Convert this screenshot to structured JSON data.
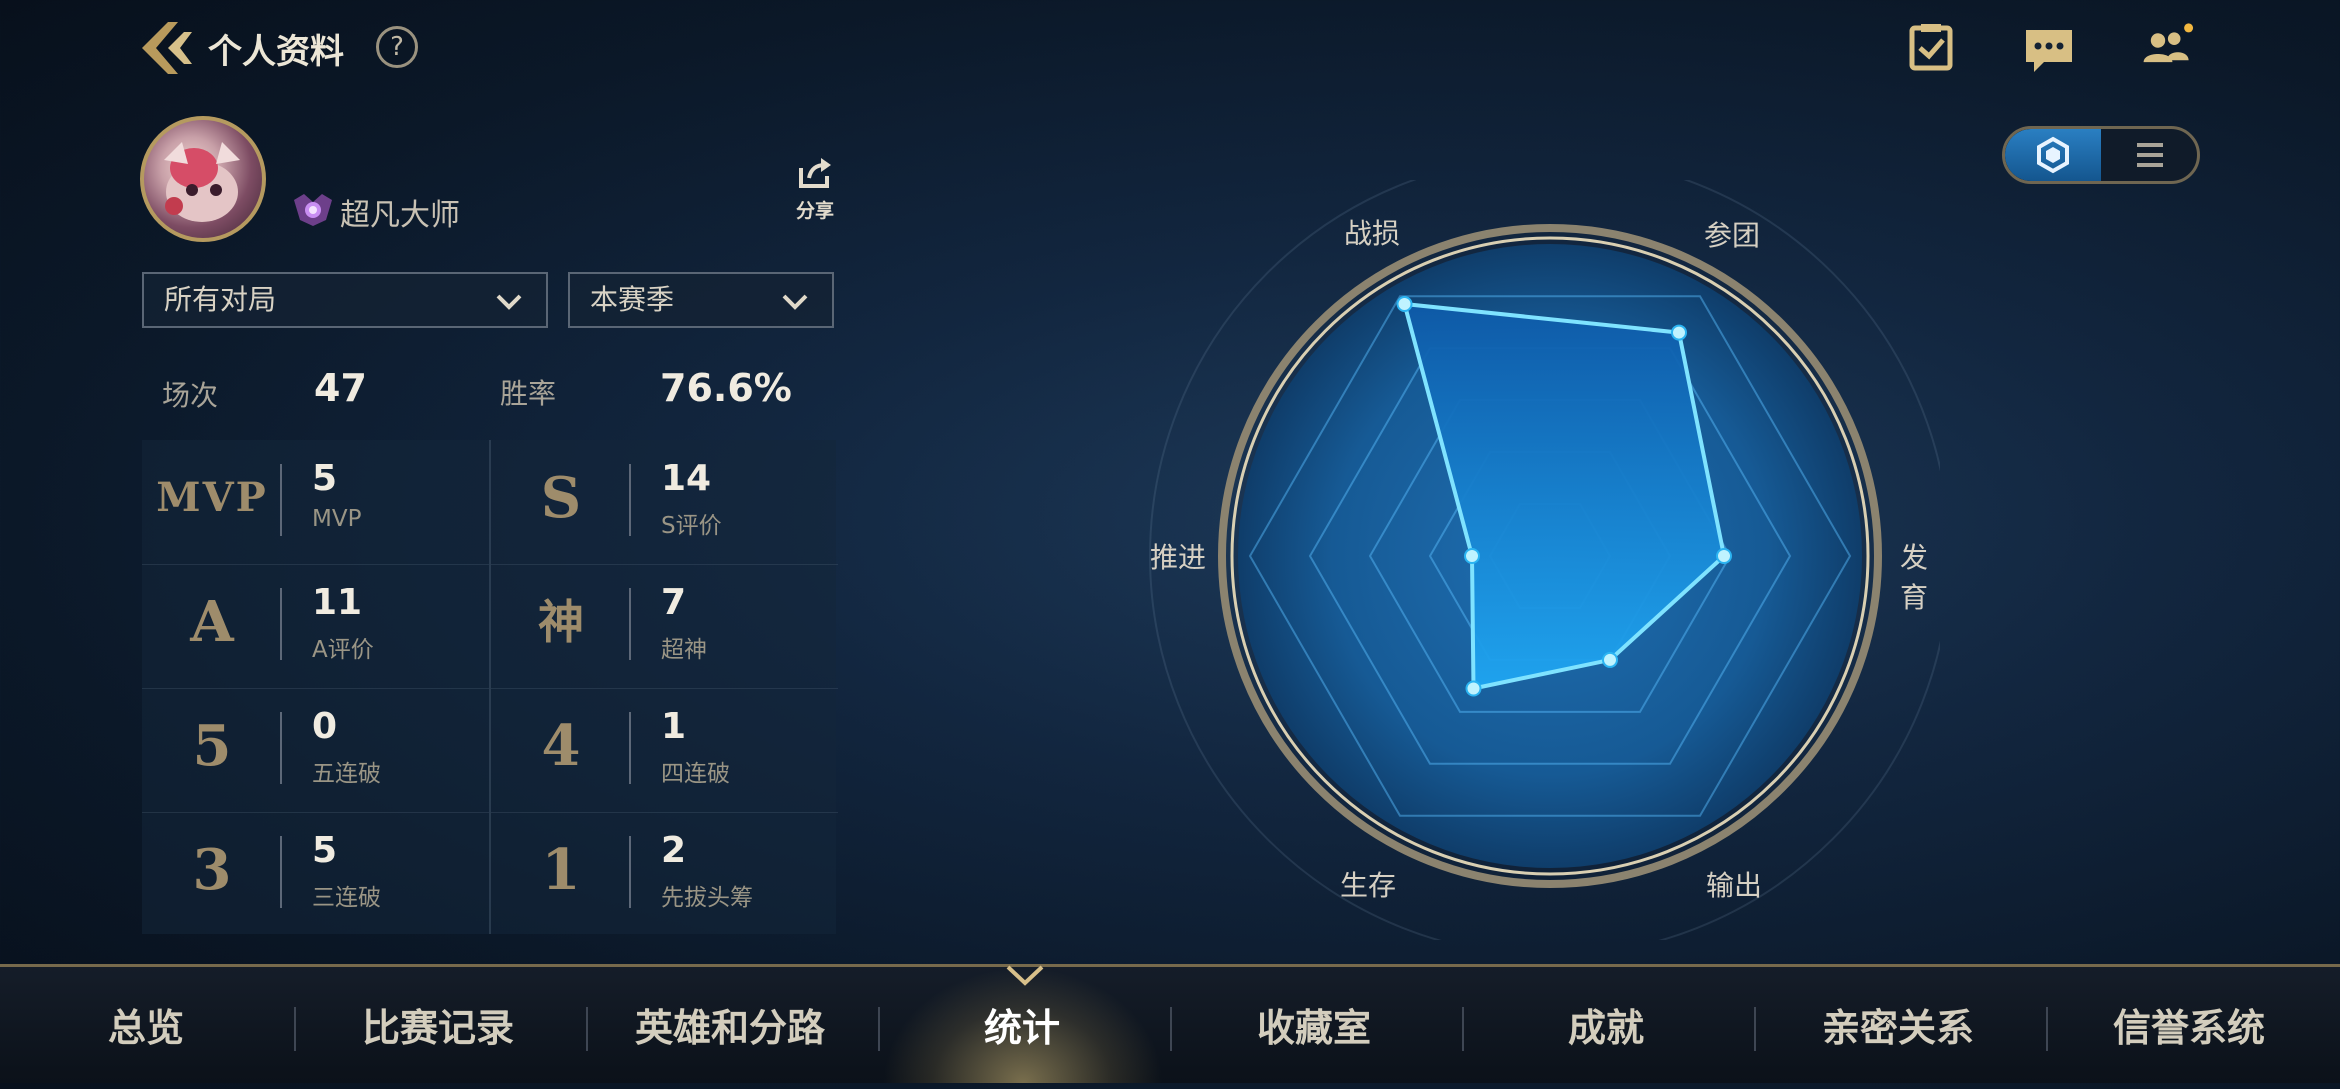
{
  "header": {
    "title": "个人资料",
    "help": "?",
    "icons": [
      "back-icon",
      "help-icon",
      "task-check-icon",
      "chat-icon",
      "friends-icon"
    ]
  },
  "profile": {
    "rank": "超凡大师",
    "share_label": "分享"
  },
  "filters": {
    "mode": "所有对局",
    "season": "本赛季"
  },
  "summary": {
    "matches_label": "场次",
    "matches_value": "47",
    "winrate_label": "胜率",
    "winrate_value": "76.6%"
  },
  "stats": [
    {
      "emblem": "MVP",
      "value": "5",
      "label": "MVP"
    },
    {
      "emblem": "S",
      "value": "14",
      "label": "S评价"
    },
    {
      "emblem": "A",
      "value": "11",
      "label": "A评价"
    },
    {
      "emblem": "神",
      "value": "7",
      "label": "超神"
    },
    {
      "emblem": "5",
      "value": "0",
      "label": "五连破"
    },
    {
      "emblem": "4",
      "value": "1",
      "label": "四连破"
    },
    {
      "emblem": "3",
      "value": "5",
      "label": "三连破"
    },
    {
      "emblem": "1",
      "value": "2",
      "label": "先拔头筹"
    }
  ],
  "radar": {
    "labels": [
      "战损",
      "参团",
      "发育",
      "输出",
      "生存",
      "推进"
    ],
    "values": [
      0.97,
      0.86,
      0.58,
      0.4,
      0.51,
      0.26
    ]
  },
  "view_toggle": {
    "active": "radar",
    "options": [
      "hexagon-icon",
      "list-icon"
    ]
  },
  "nav": {
    "items": [
      "总览",
      "比赛记录",
      "英雄和分路",
      "统计",
      "收藏室",
      "成就",
      "亲密关系",
      "信誉系统"
    ],
    "active_index": 3
  },
  "colors": {
    "accent_gold": "#b59a5f",
    "radar_blue": "#1f9ee8",
    "highlight_cyan": "#6fe0ff"
  }
}
